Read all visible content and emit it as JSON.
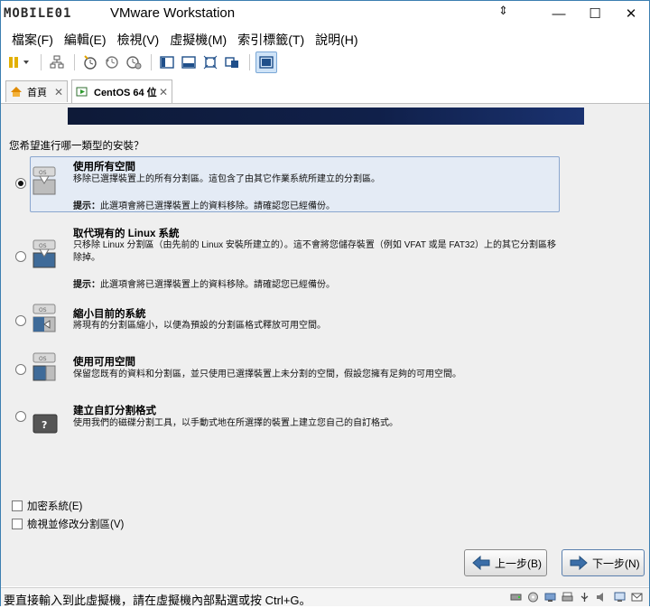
{
  "window": {
    "logo_text": "MOBILE01",
    "title": "VMware Workstation",
    "controls": {
      "minimize": "—",
      "maximize": "☐",
      "close": "✕",
      "pin": "⇕"
    }
  },
  "menu": [
    "檔案(F)",
    "編輯(E)",
    "檢視(V)",
    "虛擬機(M)",
    "索引標籤(T)",
    "說明(H)"
  ],
  "tabs": [
    {
      "label": "首頁",
      "close": "✕"
    },
    {
      "label": "CentOS 64 位",
      "close": "✕"
    }
  ],
  "installer": {
    "question": "您希望進行哪一類型的安裝？",
    "options": [
      {
        "title": "使用所有空間",
        "desc": "移除已選擇裝置上的所有分割區。這包含了由其它作業系統所建立的分割區。",
        "tip_label": "提示：",
        "tip": "此選項會將已選擇裝置上的資料移除。請確認您已經備份。",
        "disk_text": "OS"
      },
      {
        "title": "取代現有的 Linux 系統",
        "desc": "只移除 Linux 分割區（由先前的 Linux 安裝所建立的）。這不會將您儲存裝置（例如 VFAT 或是 FAT32）上的其它分割區移除掉。",
        "tip_label": "提示：",
        "tip": "此選項會將已選擇裝置上的資料移除。請確認您已經備份。",
        "disk_text": "OS"
      },
      {
        "title": "縮小目前的系統",
        "desc": "將現有的分割區縮小，以便為預設的分割區格式釋放可用空間。",
        "disk_text": "OS"
      },
      {
        "title": "使用可用空間",
        "desc": "保留您既有的資料和分割區，並只使用已選擇裝置上未分割的空間，假設您擁有足夠的可用空間。",
        "disk_text": "OS"
      },
      {
        "title": "建立自訂分割格式",
        "desc": "使用我們的磁碟分割工具，以手動式地在所選擇的裝置上建立您自己的自訂格式。",
        "disk_text": "?"
      }
    ],
    "checkboxes": [
      "加密系統(E)",
      "檢視並修改分割區(V)"
    ],
    "back_label": "上一步(B)",
    "next_label": "下一步(N)"
  },
  "status": {
    "text": "要直接輸入到此虛擬機，請在虛擬機內部點選或按 Ctrl+G。"
  },
  "colors": {
    "accent": "#3c7fb1",
    "selected_bg": "#e4ebf5",
    "banner": "#0e1a38"
  }
}
